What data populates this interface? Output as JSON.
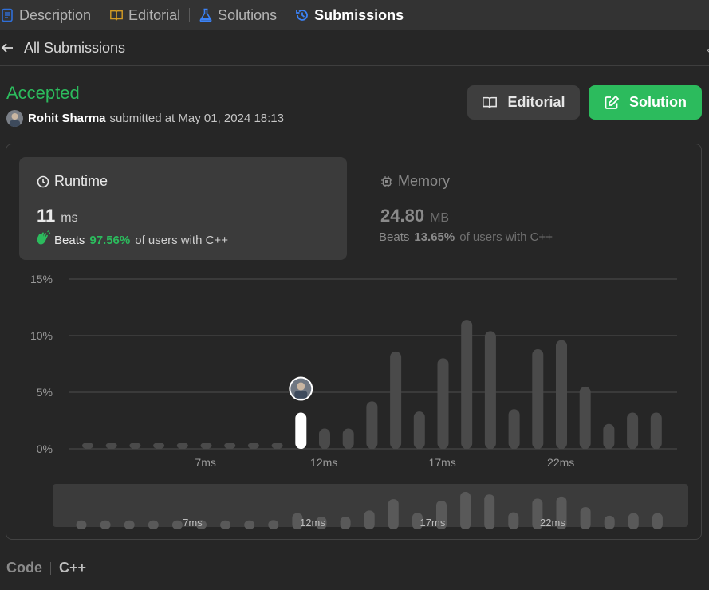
{
  "tabs": [
    {
      "label": "Description",
      "icon": "description-icon"
    },
    {
      "label": "Editorial",
      "icon": "book-icon"
    },
    {
      "label": "Solutions",
      "icon": "flask-icon"
    },
    {
      "label": "Submissions",
      "icon": "history-icon",
      "active": true
    }
  ],
  "nav": {
    "back_label": "All Submissions"
  },
  "submission": {
    "status": "Accepted",
    "user": "Rohit Sharma",
    "submitted_text": "submitted at May 01, 2024 18:13"
  },
  "actions": {
    "editorial_label": "Editorial",
    "solution_label": "Solution"
  },
  "runtime": {
    "label": "Runtime",
    "value": "11",
    "unit": "ms",
    "beats_word": "Beats",
    "beats_pct": "97.56%",
    "beats_suffix": "of users with C++"
  },
  "memory": {
    "label": "Memory",
    "value": "24.80",
    "unit": "MB",
    "beats_word": "Beats",
    "beats_pct": "13.65%",
    "beats_suffix": "of users with C++"
  },
  "footer": {
    "code_label": "Code",
    "lang": "C++"
  },
  "colors": {
    "accent_green": "#2cbb5d",
    "bar": "#4a4a4a",
    "bar_highlight": "#ffffff",
    "background": "#262626"
  },
  "chart_data": {
    "type": "bar",
    "y_ticks": [
      "15%",
      "10%",
      "5%",
      "0%"
    ],
    "ylim": [
      0,
      15
    ],
    "x_tick_labels": [
      {
        "label": "7ms",
        "index": 5
      },
      {
        "label": "12ms",
        "index": 10
      },
      {
        "label": "17ms",
        "index": 15
      },
      {
        "label": "22ms",
        "index": 20
      }
    ],
    "values": [
      0.4,
      0.4,
      0.4,
      0.4,
      0.4,
      0.5,
      0.4,
      0.4,
      0.5,
      3.2,
      1.8,
      1.8,
      4.2,
      8.6,
      3.3,
      8.0,
      11.4,
      10.4,
      3.5,
      8.8,
      9.6,
      5.5,
      2.2,
      3.2,
      3.2
    ],
    "highlight_index": 9,
    "highlight_label": "11 ms (your submission)"
  }
}
